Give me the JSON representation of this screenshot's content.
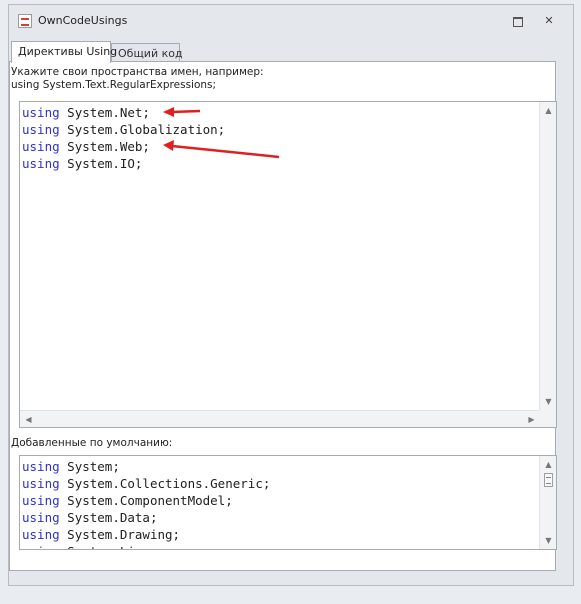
{
  "window": {
    "title": "OwnCodeUsings"
  },
  "tabs": [
    {
      "label": "Директивы Using",
      "active": true
    },
    {
      "label": "Общий код",
      "active": false
    }
  ],
  "hint": {
    "line1": "Укажите свои пространства имен, например:",
    "line2": "using System.Text.RegularExpressions;"
  },
  "user_usings": [
    {
      "keyword": "using",
      "namespace": "System.Net;"
    },
    {
      "keyword": "using",
      "namespace": "System.Globalization;"
    },
    {
      "keyword": "using",
      "namespace": "System.Web;"
    },
    {
      "keyword": "using",
      "namespace": "System.IO;"
    }
  ],
  "default_label": "Добавленные по умолчанию:",
  "default_usings": [
    {
      "keyword": "using",
      "namespace": "System;"
    },
    {
      "keyword": "using",
      "namespace": "System.Collections.Generic;"
    },
    {
      "keyword": "using",
      "namespace": "System.ComponentModel;"
    },
    {
      "keyword": "using",
      "namespace": "System.Data;"
    },
    {
      "keyword": "using",
      "namespace": "System.Drawing;"
    },
    {
      "keyword": "using",
      "namespace": "System.Linq;"
    }
  ],
  "colors": {
    "keyword": "#2f2fd6",
    "annotation_arrow": "#e02020"
  },
  "icons": {
    "app": "code-file-icon",
    "restore": "restore-window-icon",
    "close": "close-icon"
  }
}
